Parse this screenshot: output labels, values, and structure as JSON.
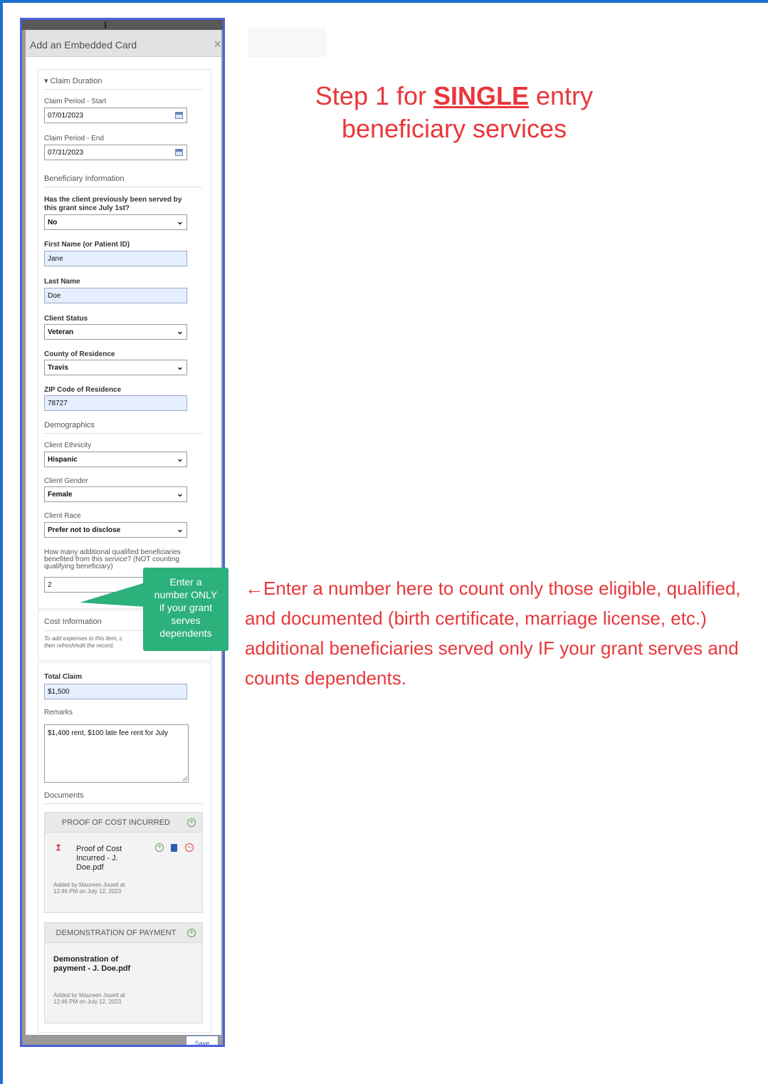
{
  "dialog": {
    "title": "Add an Embedded Card",
    "close_glyph": "×",
    "save_label": "Save"
  },
  "claim_duration": {
    "header": "▾ Claim Duration",
    "start_label": "Claim Period - Start",
    "start_value": "07/01/2023",
    "end_label": "Claim Period - End",
    "end_value": "07/31/2023"
  },
  "beneficiary": {
    "header": "Beneficiary Information",
    "served_q_line1": "Has the client previously been served by",
    "served_q_line2": "this grant since July 1st?",
    "served_value": "No",
    "first_name_label": "First Name (or Patient ID)",
    "first_name_value": "Jane",
    "last_name_label": "Last Name",
    "last_name_value": "Doe",
    "status_label": "Client Status",
    "status_value": "Veteran",
    "county_label": "County of Residence",
    "county_value": "Travis",
    "zip_label": "ZIP Code of Residence",
    "zip_value": "78727"
  },
  "demographics": {
    "header": "Demographics",
    "ethnicity_label": "Client Ethnicity",
    "ethnicity_value": "Hispanic",
    "gender_label": "Client Gender",
    "gender_value": "Female",
    "race_label": "Client Race",
    "race_value": "Prefer not to disclose",
    "additional_q_line1": "How many additional qualified beneficiaries",
    "additional_q_line2": "benefited from this service? (NOT counting",
    "additional_q_line3": "qualifying beneficiary)",
    "additional_value": "2"
  },
  "cost_info": {
    "header": "Cost Information",
    "note_line1": "To add expenses to this item, c",
    "note_line2": "then refresh/edit the record."
  },
  "claim": {
    "total_label": "Total Claim",
    "total_value": "$1,500",
    "remarks_label": "Remarks",
    "remarks_value": "$1,400 rent, $100 late fee rent for July"
  },
  "documents": {
    "header": "Documents",
    "groups": [
      {
        "title": "PROOF OF COST INCURRED",
        "file_name": "Proof of Cost Incurred - J. Doe.pdf",
        "meta": "Added by Maureen Jouett at 12:46 PM on July 12, 2023"
      },
      {
        "title": "DEMONSTRATION OF PAYMENT",
        "file_name": "Demonstration of payment - J. Doe.pdf",
        "meta": "Added by Maureen Jouett at 12:46 PM on July 12, 2023"
      }
    ]
  },
  "callout": {
    "text_line1": "Enter a",
    "text_line2": "number ONLY",
    "text_line3": "if your grant",
    "text_line4": "serves",
    "text_line5": "dependents"
  },
  "annotations": {
    "step_prefix": "Step 1 for ",
    "step_emphasis": "SINGLE",
    "step_suffix": " entry",
    "step_line2": "beneficiary services",
    "note": "←Enter a number here to count only those eligible, qualified, and documented (birth certificate, marriage license, etc.) additional beneficiaries served only IF your grant serves and counts dependents."
  },
  "colors": {
    "annotation_red": "#e8373b",
    "callout_green": "#2cb07c",
    "frame_blue": "#4b61d9"
  },
  "icons": [
    "calendar-icon",
    "chevron-down-icon",
    "close-icon",
    "add-circle-icon",
    "remove-circle-icon",
    "pdf-file-icon",
    "document-icon"
  ]
}
